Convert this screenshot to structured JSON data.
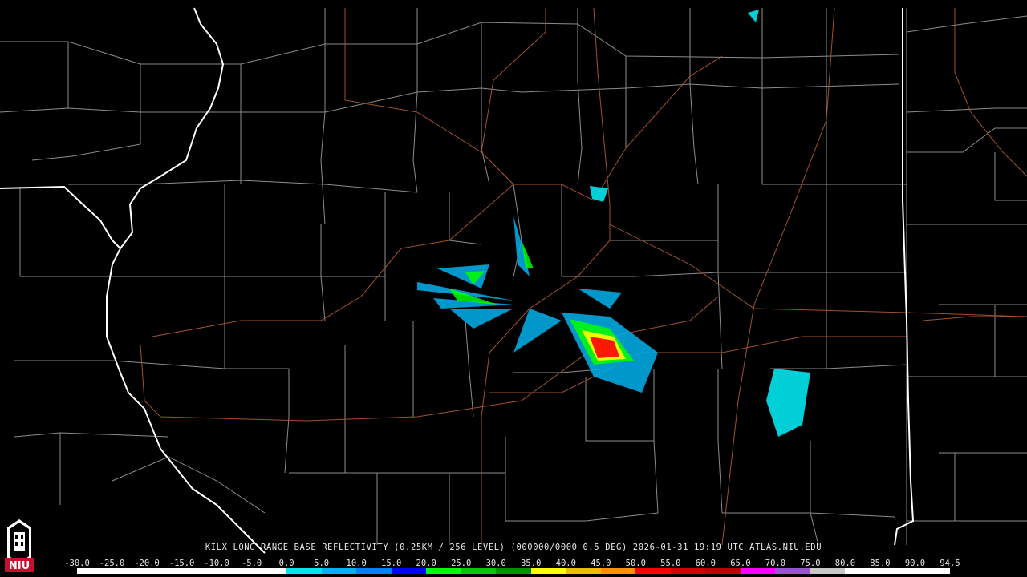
{
  "product": {
    "caption": "KILX LONG RANGE BASE REFLECTIVITY (0.25KM / 256 LEVEL) (000000/0000 0.5 DEG) 2026-01-31 19:19 UTC  ATLAS.NIU.EDU"
  },
  "scale": {
    "labels": [
      "-30.0",
      "-25.0",
      "-20.0",
      "-15.0",
      "-10.0",
      "-5.0",
      "0.0",
      "5.0",
      "10.0",
      "15.0",
      "20.0",
      "25.0",
      "30.0",
      "35.0",
      "40.0",
      "45.0",
      "50.0",
      "55.0",
      "60.0",
      "65.0",
      "70.0",
      "75.0",
      "80.0",
      "85.0",
      "90.0",
      "94.5"
    ],
    "colors": [
      "#ffffff",
      "#ffffff",
      "#ffffff",
      "#ffffff",
      "#ffffff",
      "#ffffff",
      "#00e5ee",
      "#00b2ee",
      "#0080ff",
      "#0000ff",
      "#00ff00",
      "#00c800",
      "#009000",
      "#ffff00",
      "#e8c000",
      "#ff9000",
      "#ff0000",
      "#d60000",
      "#c00000",
      "#ff00ff",
      "#9955c9",
      "#c8c8c8",
      "#ffffff",
      "#ffffff",
      "#ffffff"
    ]
  },
  "colors": {
    "background": "#000000",
    "county_lines": "#8c8c8c",
    "state_lines": "#ffffff",
    "highways": "#a0522d"
  },
  "icons": {
    "logo": "niu-logo"
  }
}
